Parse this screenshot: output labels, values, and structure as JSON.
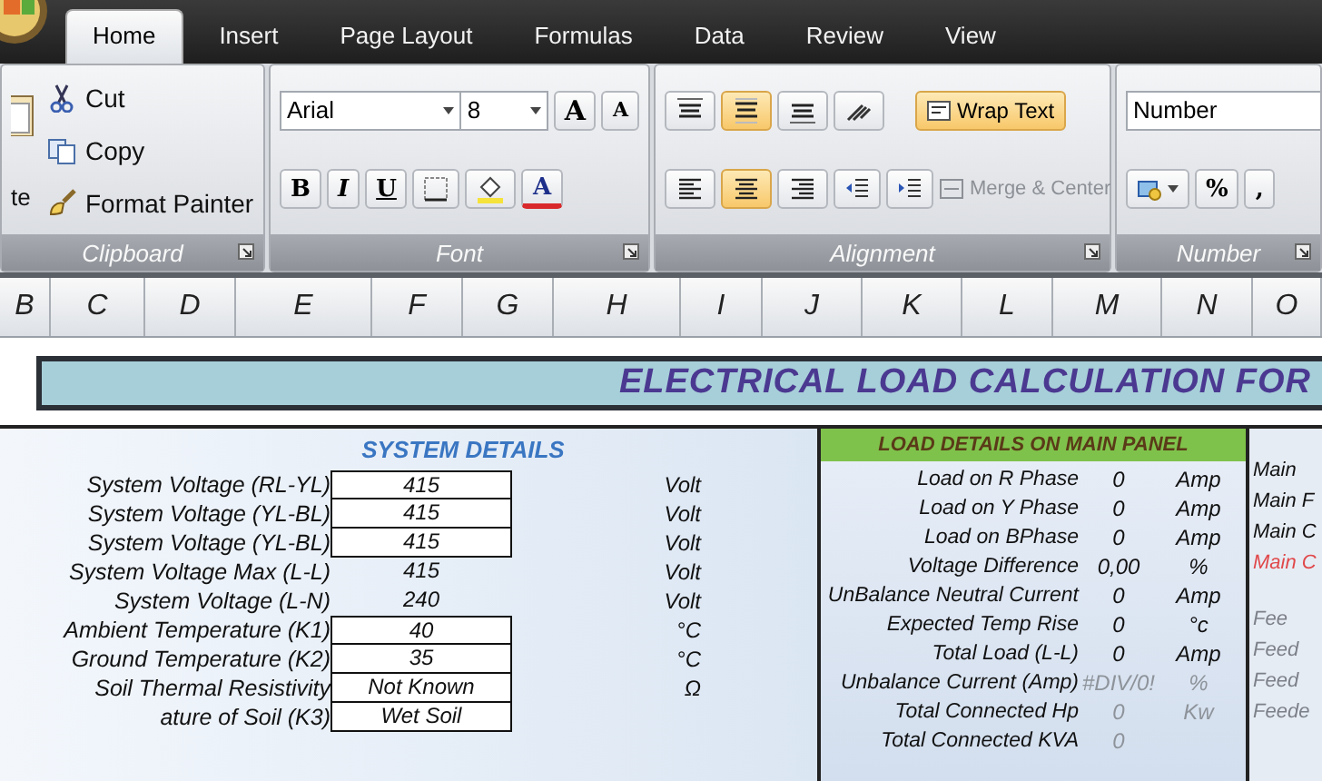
{
  "tabs": [
    {
      "label": "Home",
      "selected": true
    },
    {
      "label": "Insert",
      "selected": false
    },
    {
      "label": "Page Layout",
      "selected": false
    },
    {
      "label": "Formulas",
      "selected": false
    },
    {
      "label": "Data",
      "selected": false
    },
    {
      "label": "Review",
      "selected": false
    },
    {
      "label": "View",
      "selected": false
    }
  ],
  "ribbon": {
    "clipboard": {
      "title": "Clipboard",
      "paste_label": "te",
      "items": [
        "Cut",
        "Copy",
        "Format Painter"
      ]
    },
    "font": {
      "title": "Font",
      "font_name": "Arial",
      "font_size": "8",
      "grow": "A",
      "shrink": "A",
      "bold": "B",
      "italic": "I",
      "underline": "U",
      "font_color": "A"
    },
    "alignment": {
      "title": "Alignment",
      "vertical": [
        {
          "selected": false
        },
        {
          "selected": true
        },
        {
          "selected": false
        }
      ],
      "horizontal": [
        {
          "selected": false
        },
        {
          "selected": true
        },
        {
          "selected": false
        }
      ],
      "wrap_text": {
        "label": "Wrap Text",
        "selected": true
      },
      "merge": {
        "label": "Merge & Center",
        "disabled": true
      }
    },
    "number": {
      "title": "Number",
      "format": "Number",
      "percent": "%",
      "comma": ","
    }
  },
  "columns": [
    "B",
    "C",
    "D",
    "E",
    "F",
    "G",
    "H",
    "I",
    "J",
    "K",
    "L",
    "M",
    "N",
    "O"
  ],
  "banner": {
    "title": "ELECTRICAL LOAD CALCULATION FOR"
  },
  "system_details": {
    "title": "SYSTEM DETAILS",
    "rows": [
      {
        "label": "System Voltage (RL-YL)",
        "value": "415",
        "unit": "Volt",
        "editable": true
      },
      {
        "label": "System Voltage (YL-BL)",
        "value": "415",
        "unit": "Volt",
        "editable": true
      },
      {
        "label": "System Voltage (YL-BL)",
        "value": "415",
        "unit": "Volt",
        "editable": true
      },
      {
        "label": "System Voltage Max (L-L)",
        "value": "415",
        "unit": "Volt",
        "editable": false
      },
      {
        "label": "System Voltage (L-N)",
        "value": "240",
        "unit": "Volt",
        "editable": false
      },
      {
        "label": "Ambient Temperature (K1)",
        "value": "40",
        "unit": "°C",
        "editable": true
      },
      {
        "label": "Ground Temperature (K2)",
        "value": "35",
        "unit": "°C",
        "editable": true
      },
      {
        "label": "Soil Thermal Resistivity",
        "value": "Not Known",
        "unit": "Ω",
        "editable": true
      },
      {
        "label": "ature of Soil (K3)",
        "value": "Wet Soil",
        "editable": true
      }
    ]
  },
  "load_details": {
    "title": "LOAD DETAILS ON MAIN PANEL",
    "rows": [
      {
        "label": "Load on R Phase",
        "value": "0",
        "unit": "Amp",
        "dimmed": false
      },
      {
        "label": "Load on Y Phase",
        "value": "0",
        "unit": "Amp",
        "dimmed": false
      },
      {
        "label": "Load on BPhase",
        "value": "0",
        "unit": "Amp",
        "dimmed": false
      },
      {
        "label": "Voltage Difference",
        "value": "0,00",
        "unit": "%",
        "dimmed": false
      },
      {
        "label": "UnBalance Neutral Current",
        "value": "0",
        "unit": "Amp",
        "dimmed": false
      },
      {
        "label": "Expected Temp Rise",
        "value": "0",
        "unit": "°c",
        "dimmed": false
      },
      {
        "label": "Total Load (L-L)",
        "value": "0",
        "unit": "Amp",
        "dimmed": false
      },
      {
        "label": "Unbalance Current (Amp)",
        "value": "#DIV/0!",
        "unit": "%",
        "dimmed": true
      },
      {
        "label": "Total Connected Hp",
        "value": "0",
        "unit": "Kw",
        "dimmed": true
      },
      {
        "label": "Total Connected KVA",
        "value": "0",
        "dimmed": true
      }
    ]
  },
  "right_panel": {
    "items": [
      {
        "label": "Main",
        "kind": "normal"
      },
      {
        "label": "Main F",
        "kind": "normal"
      },
      {
        "label": "Main C",
        "kind": "normal"
      },
      {
        "label": "Main C",
        "kind": "alert"
      },
      {
        "label": "Fee",
        "kind": "muted"
      },
      {
        "label": "Feed",
        "kind": "muted"
      },
      {
        "label": "Feed",
        "kind": "muted"
      },
      {
        "label": "Feede",
        "kind": "muted"
      }
    ]
  }
}
